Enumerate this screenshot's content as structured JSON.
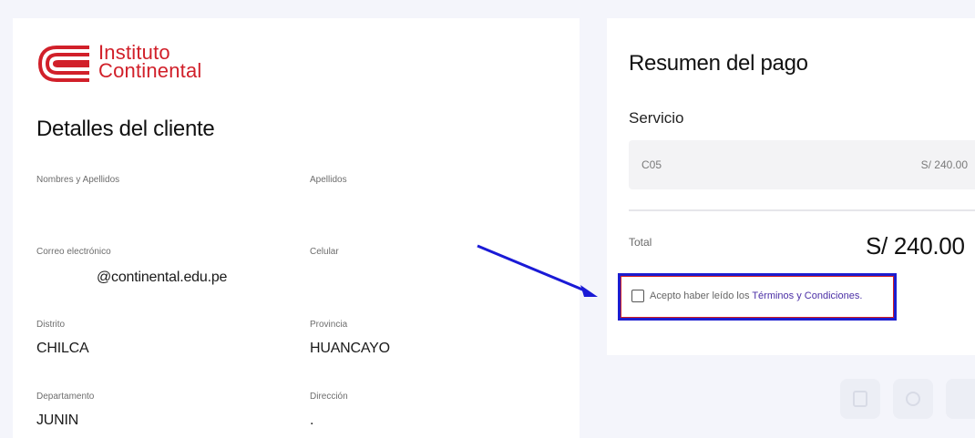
{
  "brand": {
    "name_line1": "Instituto",
    "name_line2": "Continental",
    "color": "#d1202a"
  },
  "client": {
    "title": "Detalles del cliente",
    "fields": {
      "nombres": {
        "label": "Nombres y Apellidos",
        "value": ""
      },
      "apellidos": {
        "label": "Apellidos",
        "value": ""
      },
      "correo": {
        "label": "Correo electrónico",
        "value": "@continental.edu.pe"
      },
      "celular": {
        "label": "Celular",
        "value": ""
      },
      "distrito": {
        "label": "Distrito",
        "value": "CHILCA"
      },
      "provincia": {
        "label": "Provincia",
        "value": "HUANCAYO"
      },
      "departamento": {
        "label": "Departamento",
        "value": "JUNIN"
      },
      "direccion": {
        "label": "Dirección",
        "value": "."
      }
    }
  },
  "summary": {
    "title": "Resumen del pago",
    "service_label": "Servicio",
    "service_code": "C05",
    "service_price": "S/ 240.00",
    "total_label": "Total",
    "total_value": "S/ 240.00",
    "terms_prefix": "Acepto haber leído los ",
    "terms_link": "Términos y Condiciones.",
    "terms_checked": false
  },
  "colors": {
    "highlight_border": "#1c1ccf",
    "annotation_arrow": "#1a1ad6",
    "link": "#4b2fa6"
  }
}
